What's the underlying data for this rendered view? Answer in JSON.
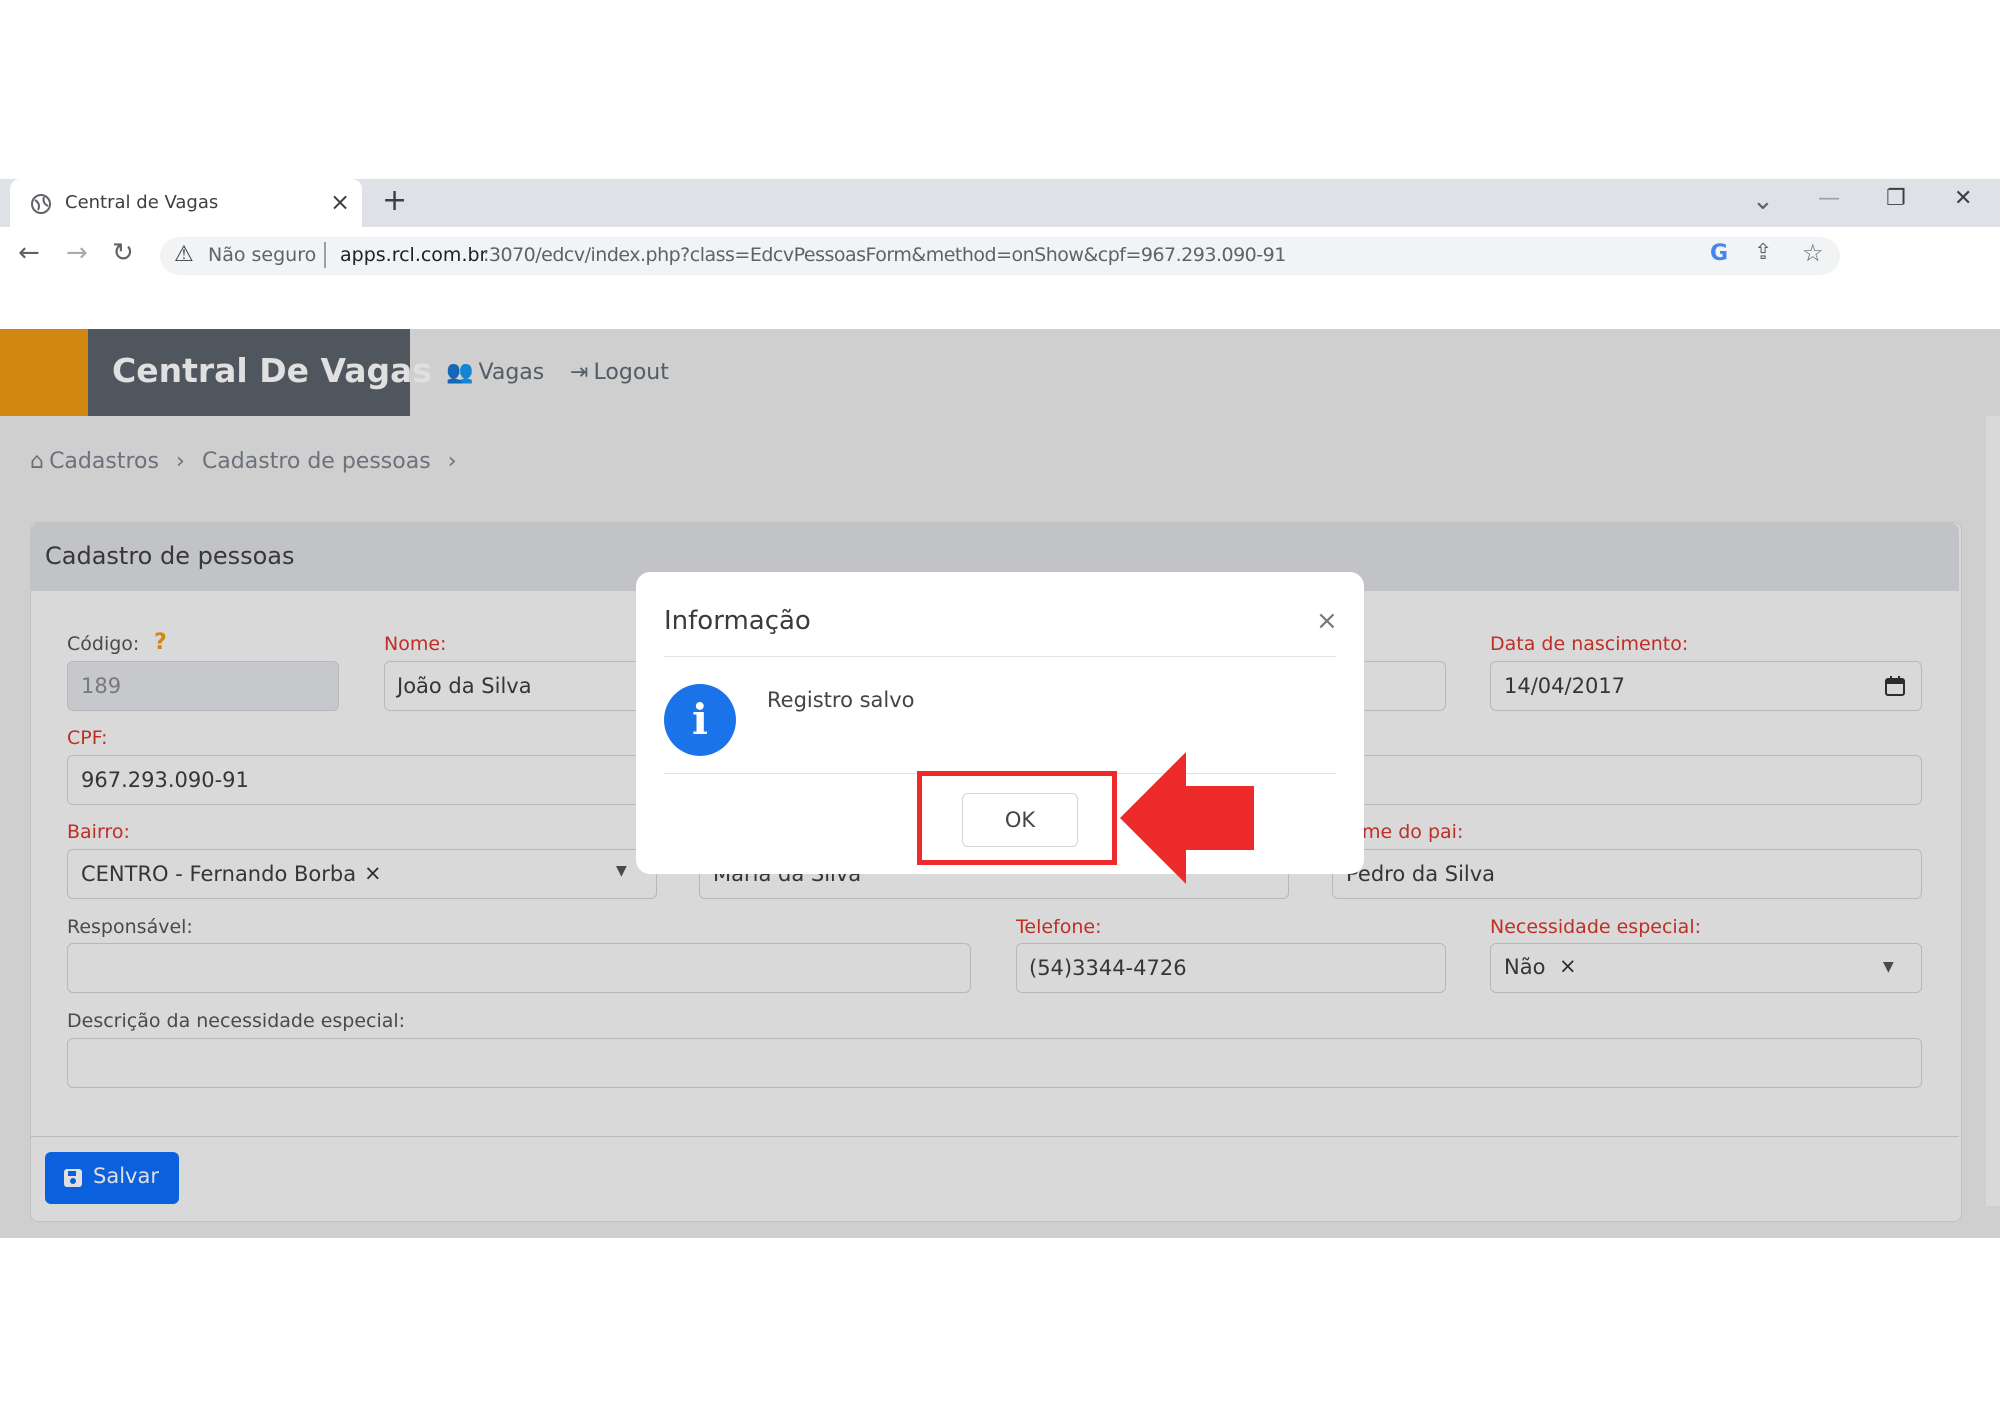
{
  "browser": {
    "tab_title": "Central de Vagas",
    "tab_close": "×",
    "new_tab": "+",
    "window_controls": {
      "minimize": "—",
      "restore": "❐",
      "close": "✕",
      "tab_search": "⌄"
    },
    "security_label": "Não seguro",
    "url_host": "apps.rcl.com.br",
    "url_rest": ":3070/edcv/index.php?class=EdcvPessoasForm&method=onShow&cpf=967.293.090-91"
  },
  "app": {
    "brand": "Central De Vagas",
    "nav": [
      {
        "label": "Vagas",
        "icon": "users-icon"
      },
      {
        "label": "Logout",
        "icon": "sign-out-icon"
      }
    ],
    "breadcrumb": [
      "Cadastros",
      "Cadastro de pessoas"
    ]
  },
  "form": {
    "title": "Cadastro de pessoas",
    "codigo": {
      "label": "Código:",
      "help": "?",
      "value": "189"
    },
    "nome": {
      "label": "Nome:",
      "value": "João da Silva"
    },
    "data_nascimento": {
      "label": "Data de nascimento:",
      "value": "14/04/2017"
    },
    "cpf": {
      "label": "CPF:",
      "value": "967.293.090-91"
    },
    "bairro": {
      "label": "Bairro:",
      "value": "CENTRO - Fernando Borba",
      "clear": "×"
    },
    "nome_mae": {
      "value": "Maria da Silva"
    },
    "nome_pai": {
      "label": "me do pai:",
      "value": "Pedro da Silva"
    },
    "responsavel": {
      "label": "Responsável:",
      "value": ""
    },
    "telefone": {
      "label": "Telefone:",
      "value": "(54)3344-4726"
    },
    "necessidade": {
      "label": "Necessidade especial:",
      "value": "Não",
      "clear": "×"
    },
    "descricao": {
      "label": "Descrição da necessidade especial:",
      "value": ""
    },
    "save_label": "Salvar"
  },
  "modal": {
    "title": "Informação",
    "close": "×",
    "message": "Registro salvo",
    "ok_label": "OK"
  },
  "colors": {
    "accent_orange": "#f09a14",
    "brand_bar": "#5b626c",
    "save_blue": "#0d6efd",
    "required_red": "#d9362b",
    "highlight_red": "#ee2b2b",
    "info_blue": "#1a73e8"
  }
}
